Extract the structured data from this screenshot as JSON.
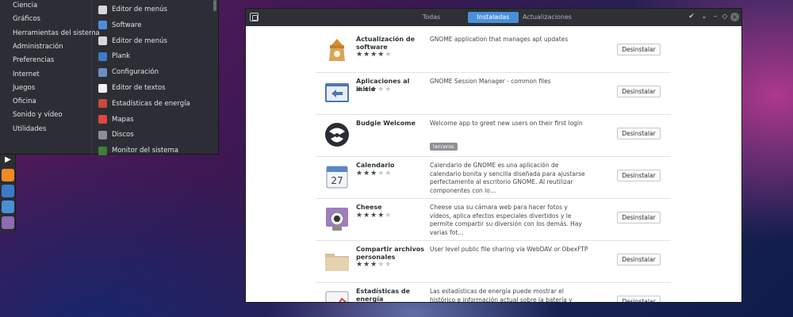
{
  "menu": {
    "categories": [
      "Ciencia",
      "Gráficos",
      "Herramientas del sistema",
      "Administración",
      "Preferencias",
      "Internet",
      "Juegos",
      "Oficina",
      "Sonido y vídeo",
      "Utilidades"
    ],
    "apps": [
      {
        "label": "Editor de menús",
        "icon": "menu-editor-icon",
        "color": "#d8d8d8"
      },
      {
        "label": "Software",
        "icon": "software-icon",
        "color": "#4a90d9"
      },
      {
        "label": "Editor de menús",
        "icon": "menu-editor-icon",
        "color": "#d8d8d8"
      },
      {
        "label": "Plank",
        "icon": "plank-icon",
        "color": "#3b7bc8"
      },
      {
        "label": "Configuración",
        "icon": "settings-icon",
        "color": "#6c8ebf"
      },
      {
        "label": "Editor de textos",
        "icon": "text-editor-icon",
        "color": "#f2f2f2"
      },
      {
        "label": "Estadísticas de energía",
        "icon": "power-stats-icon",
        "color": "#c84a3c"
      },
      {
        "label": "Mapas",
        "icon": "maps-icon",
        "color": "#e0473f"
      },
      {
        "label": "Discos",
        "icon": "disks-icon",
        "color": "#8a8f96"
      },
      {
        "label": "Monitor del sistema",
        "icon": "system-monitor-icon",
        "color": "#3e7d3a"
      }
    ]
  },
  "dock": {
    "items": [
      {
        "icon": "files-icon",
        "color": "#d9d9d9",
        "glyph": ""
      },
      {
        "icon": "app-icon",
        "color": "#c84a3c",
        "glyph": ""
      },
      {
        "icon": "app-icon",
        "color": "#e7a33b",
        "glyph": ""
      },
      {
        "icon": "app-icon",
        "color": "#c84a3c",
        "glyph": ""
      },
      {
        "icon": "terminal-icon",
        "color": "#2e2e2e",
        "glyph": "▶"
      },
      {
        "icon": "software-center-icon",
        "color": "#f08a24",
        "glyph": ""
      },
      {
        "icon": "screenshot-icon",
        "color": "#3b7bc8",
        "glyph": ""
      },
      {
        "icon": "browser-icon",
        "color": "#4a8fd6",
        "glyph": ""
      },
      {
        "icon": "folder-icon",
        "color": "#8f6bb5",
        "glyph": ""
      }
    ]
  },
  "window": {
    "tabs": [
      "Todas",
      "Instaladas",
      "Actualizaciones"
    ],
    "active_tab": "Instaladas",
    "controls": {
      "check": "✔",
      "pin": "⌄",
      "minimize": "–",
      "maximize": "◇",
      "close": "×"
    }
  },
  "apps": [
    {
      "name": "Actualización de software",
      "stars": 4,
      "description": "GNOME application that manages apt updates",
      "button": "Desinstalar",
      "icon": "software-update-icon",
      "tag": ""
    },
    {
      "name": "Aplicaciones al inicio",
      "stars": 3,
      "description": "GNOME Session Manager - common files",
      "button": "Desinstalar",
      "icon": "startup-apps-icon",
      "tag": ""
    },
    {
      "name": "Budgie Welcome",
      "stars": 0,
      "description": "Welcome app to greet new users on their first login",
      "button": "Desinstalar",
      "icon": "budgie-icon",
      "tag": "terceros"
    },
    {
      "name": "Calendario",
      "stars": 3,
      "description": "Calendario de GNOME es una aplicación de calendario bonita y sencilla diseñada para ajustarse perfectamente al escritorio GNOME. Al reutilizar componentes con lo…",
      "button": "Desinstalar",
      "icon": "calendar-icon",
      "tag": ""
    },
    {
      "name": "Cheese",
      "stars": 4,
      "description": "Cheese usa su cámara web para hacer fotos y vídeos, aplica efectos especiales divertidos y le permite compartir su diversión con los demás. Hay varias fot…",
      "button": "Desinstalar",
      "icon": "webcam-icon",
      "tag": ""
    },
    {
      "name": "Compartir archivos personales",
      "stars": 3,
      "description": "User level public file sharing via WebDAV or ObexFTP",
      "button": "Desinstalar",
      "icon": "file-share-icon",
      "tag": ""
    },
    {
      "name": "Estadísticas de energía",
      "stars": 0,
      "description": "Las estadísticas de energía puede mostrar el histórico e información actual sobre la batería y sobre programas emergentes que lo usen. Es probable que sólo necesit…",
      "button": "Desinstalar",
      "icon": "power-stats-icon",
      "tag": ""
    }
  ]
}
